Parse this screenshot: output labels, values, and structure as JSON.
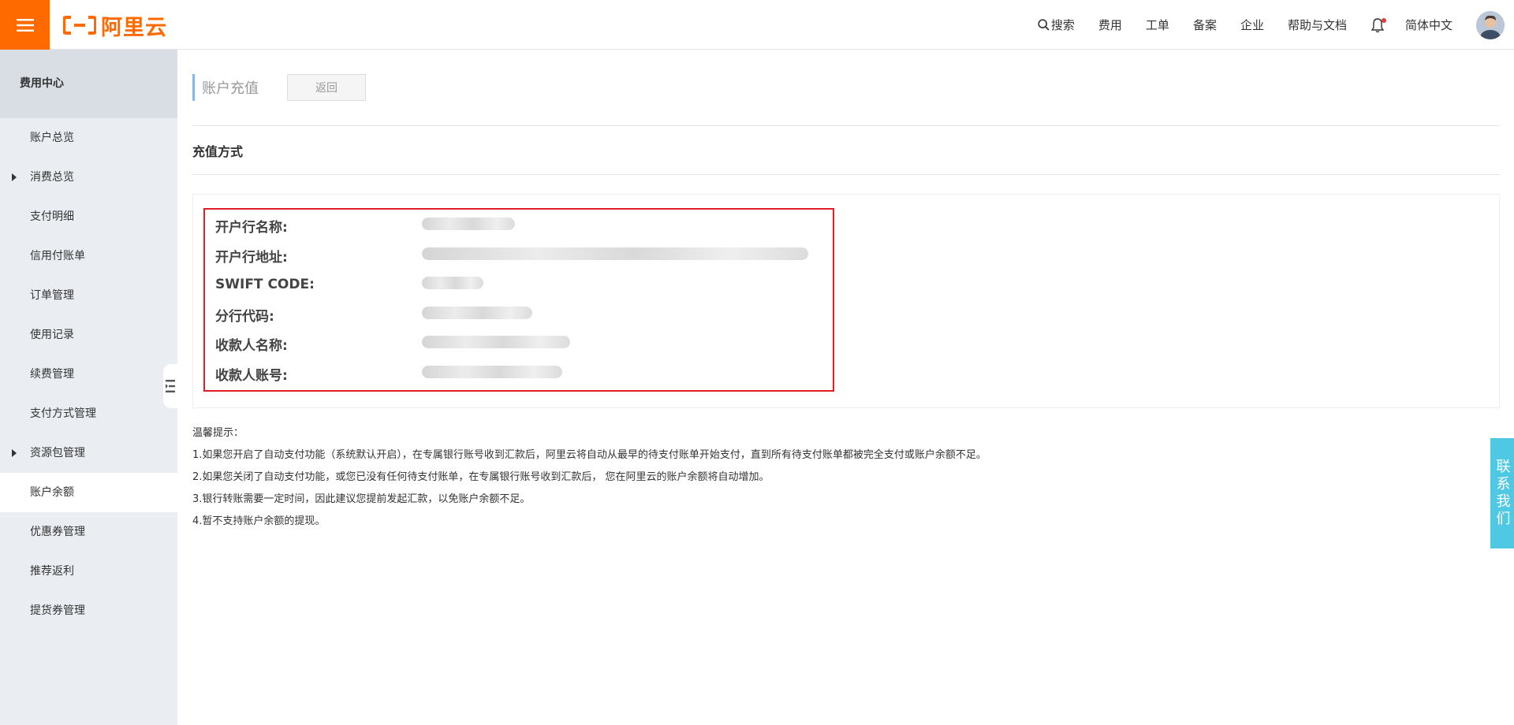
{
  "header": {
    "logo_text": "阿里云",
    "nav": {
      "search": "搜索",
      "billing": "费用",
      "ticket": "工单",
      "filing": "备案",
      "enterprise": "企业",
      "help": "帮助与文档",
      "language": "简体中文"
    }
  },
  "sidebar": {
    "title": "费用中心",
    "items": [
      {
        "label": "账户总览",
        "has_arrow": false
      },
      {
        "label": "消费总览",
        "has_arrow": true
      },
      {
        "label": "支付明细",
        "has_arrow": false
      },
      {
        "label": "信用付账单",
        "has_arrow": false
      },
      {
        "label": "订单管理",
        "has_arrow": false
      },
      {
        "label": "使用记录",
        "has_arrow": false
      },
      {
        "label": "续费管理",
        "has_arrow": false
      },
      {
        "label": "支付方式管理",
        "has_arrow": false
      },
      {
        "label": "资源包管理",
        "has_arrow": true
      },
      {
        "label": "账户余额",
        "has_arrow": false,
        "active": true
      },
      {
        "label": "优惠券管理",
        "has_arrow": false
      },
      {
        "label": "推荐返利",
        "has_arrow": false
      },
      {
        "label": "提货券管理",
        "has_arrow": false
      }
    ]
  },
  "main": {
    "page_title": "账户充值",
    "back_label": "返回",
    "section_title": "充值方式",
    "info": {
      "bank_name_label": "开户行名称:",
      "bank_address_label": "开户行地址:",
      "swift_label": "SWIFT CODE:",
      "branch_code_label": "分行代码:",
      "payee_name_label": "收款人名称:",
      "payee_account_label": "收款人账号:"
    },
    "tips": {
      "title": "温馨提示：",
      "line1": "1.如果您开启了自动支付功能（系统默认开启），在专属银行账号收到汇款后，阿里云将自动从最早的待支付账单开始支付，直到所有待支付账单都被完全支付或账户余额不足。",
      "line2": "2.如果您关闭了自动支付功能，或您已没有任何待支付账单，在专属银行账号收到汇款后， 您在阿里云的账户余额将自动增加。",
      "line3": "3.银行转账需要一定时间，因此建议您提前发起汇款，以免账户余额不足。",
      "line4": "4.暂不支持账户余额的提现。"
    }
  },
  "contact": {
    "label": "联系我们"
  },
  "colors": {
    "brand": "#ff6a00",
    "highlight_border": "#e21d28",
    "contact_tab": "#4fc8e3"
  }
}
